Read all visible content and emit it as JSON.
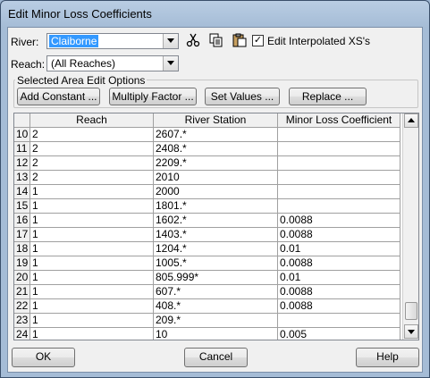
{
  "window": {
    "title": "Edit Minor Loss Coefficients"
  },
  "river": {
    "label": "River:",
    "value": "Claiborne"
  },
  "reach": {
    "label": "Reach:",
    "value": "(All Reaches)"
  },
  "toolbar": {
    "cut_icon": "scissors-icon",
    "copy_icon": "copy-icon",
    "paste_icon": "paste-icon"
  },
  "interp": {
    "label": "Edit Interpolated XS's",
    "checked": true
  },
  "edit_options": {
    "title": "Selected Area Edit Options",
    "add_constant": "Add Constant ...",
    "multiply_factor": "Multiply Factor ...",
    "set_values": "Set Values ...",
    "replace": "Replace ..."
  },
  "table": {
    "headers": [
      "Reach",
      "River Station",
      "Minor Loss Coefficient"
    ],
    "rows": [
      {
        "n": "10",
        "reach": "2",
        "station": "2607.*",
        "coef": ""
      },
      {
        "n": "11",
        "reach": "2",
        "station": "2408.*",
        "coef": ""
      },
      {
        "n": "12",
        "reach": "2",
        "station": "2209.*",
        "coef": ""
      },
      {
        "n": "13",
        "reach": "2",
        "station": "2010",
        "coef": ""
      },
      {
        "n": "14",
        "reach": "1",
        "station": "2000",
        "coef": ""
      },
      {
        "n": "15",
        "reach": "1",
        "station": "1801.*",
        "coef": ""
      },
      {
        "n": "16",
        "reach": "1",
        "station": "1602.*",
        "coef": "0.0088"
      },
      {
        "n": "17",
        "reach": "1",
        "station": "1403.*",
        "coef": "0.0088"
      },
      {
        "n": "18",
        "reach": "1",
        "station": "1204.*",
        "coef": "0.01"
      },
      {
        "n": "19",
        "reach": "1",
        "station": "1005.*",
        "coef": "0.0088"
      },
      {
        "n": "20",
        "reach": "1",
        "station": "805.999*",
        "coef": "0.01"
      },
      {
        "n": "21",
        "reach": "1",
        "station": "607.*",
        "coef": "0.0088"
      },
      {
        "n": "22",
        "reach": "1",
        "station": "408.*",
        "coef": "0.0088"
      },
      {
        "n": "23",
        "reach": "1",
        "station": "209.*",
        "coef": ""
      },
      {
        "n": "24",
        "reach": "1",
        "station": "10",
        "coef": "0.005"
      }
    ]
  },
  "buttons": {
    "ok": "OK",
    "cancel": "Cancel",
    "help": "Help"
  }
}
